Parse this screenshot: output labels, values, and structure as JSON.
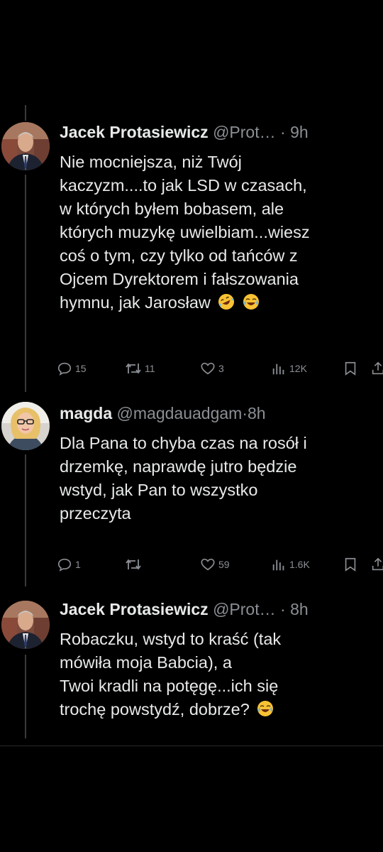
{
  "tweets": [
    {
      "name": "Jacek Protasiewicz",
      "handle": "@Prot…",
      "time": "9h",
      "lines": [
        "Nie mocniejsza, niż Twój",
        "kaczyzm....to jak LSD w czasach,",
        "w których byłem bobasem, ale",
        "których muzykę uwielbiam...wiesz",
        "coś o tym, czy tylko od tańców z",
        "Ojcem Dyrektorem i fałszowania",
        "hymnu, jak Jarosław"
      ],
      "emojis": [
        "rolling-on-floor-laughing-emoji",
        "tears-of-joy-emoji"
      ],
      "replies": "15",
      "reposts": "11",
      "likes": "3",
      "views": "12K"
    },
    {
      "name": "magda",
      "handle": "@magdauadgam",
      "time": "8h",
      "lines": [
        "Dla Pana to chyba czas na rosół i",
        "drzemkę, naprawdę jutro będzie",
        "wstyd, jak Pan to wszystko",
        "przeczyta"
      ],
      "emojis": [],
      "replies": "1",
      "reposts": "",
      "likes": "59",
      "views": "1.6K"
    },
    {
      "name": "Jacek Protasiewicz",
      "handle": "@Prot…",
      "time": "8h",
      "lines": [
        "Robaczku, wstyd to kraść (tak",
        "mówiła moja Babcia), a",
        "Twoi kradli na potęgę...ich się",
        "trochę powstydź, dobrze?"
      ],
      "emojis": [
        "tears-of-joy-emoji"
      ]
    }
  ],
  "separator": "·",
  "icons": {
    "reply": "reply-icon",
    "repost": "repost-icon",
    "like": "heart-icon",
    "views": "views-icon",
    "bookmark": "bookmark-icon",
    "share": "share-icon"
  },
  "colors": {
    "background": "#000000",
    "text": "#e7e9ea",
    "muted": "#8b8f94"
  }
}
